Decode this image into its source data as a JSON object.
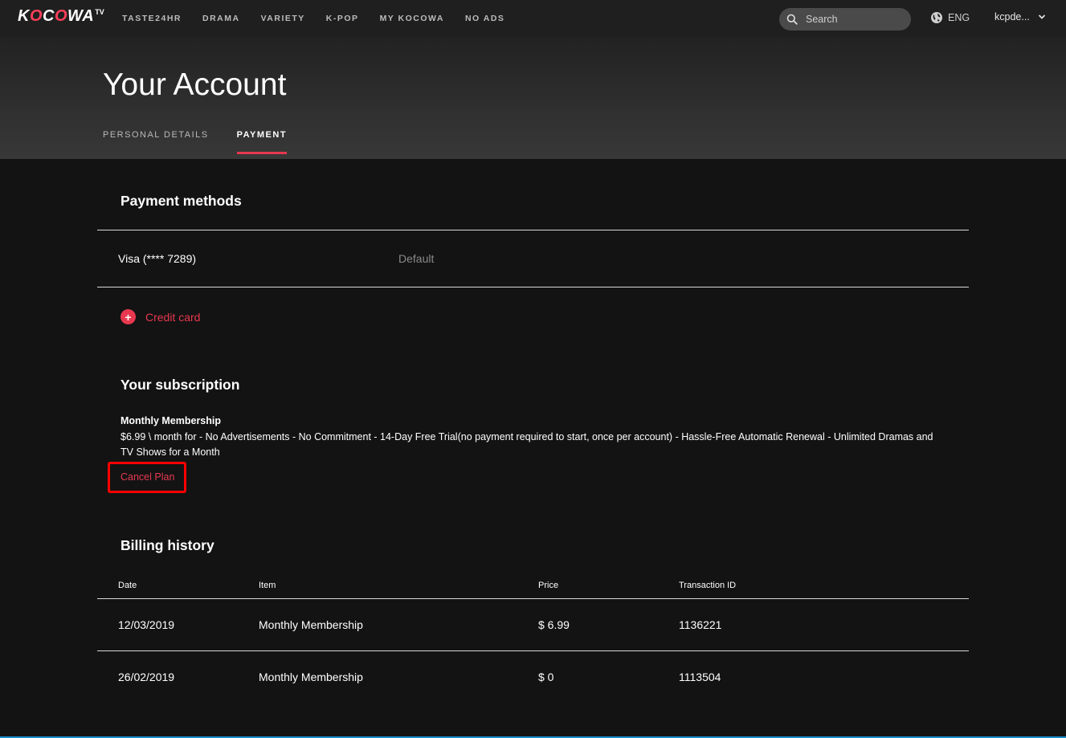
{
  "topbar": {
    "logo_text": "KOCOWA",
    "logo_tv": "TV",
    "nav": [
      "TASTE24HR",
      "DRAMA",
      "VARIETY",
      "K-POP",
      "MY KOCOWA",
      "NO ADS"
    ],
    "search_placeholder": "Search",
    "language": "ENG",
    "username": "kcpde..."
  },
  "header": {
    "title": "Your Account",
    "tabs": [
      {
        "label": "PERSONAL DETAILS",
        "active": false
      },
      {
        "label": "PAYMENT",
        "active": true
      }
    ]
  },
  "payment_methods": {
    "title": "Payment methods",
    "card_label": "Visa (**** 7289)",
    "card_status": "Default",
    "add_icon": "+",
    "add_label": "Credit card"
  },
  "subscription": {
    "title": "Your subscription",
    "plan_name": "Monthly Membership",
    "description": "$6.99 \\ month for - No Advertisements - No Commitment - 14-Day Free Trial(no payment required to start, once per account) - Hassle-Free Automatic Renewal - Unlimited Dramas and TV Shows for a Month",
    "cancel_label": "Cancel Plan"
  },
  "billing": {
    "title": "Billing history",
    "headers": {
      "date": "Date",
      "item": "Item",
      "price": "Price",
      "transaction": "Transaction ID"
    },
    "rows": [
      {
        "date": "12/03/2019",
        "item": "Monthly Membership",
        "price": "$ 6.99",
        "transaction": "1136221"
      },
      {
        "date": "26/02/2019",
        "item": "Monthly Membership",
        "price": "$ 0",
        "transaction": "1113504"
      }
    ]
  },
  "colors": {
    "accent": "#e8384f",
    "background": "#131313",
    "highlight_box": "#ff0000"
  }
}
